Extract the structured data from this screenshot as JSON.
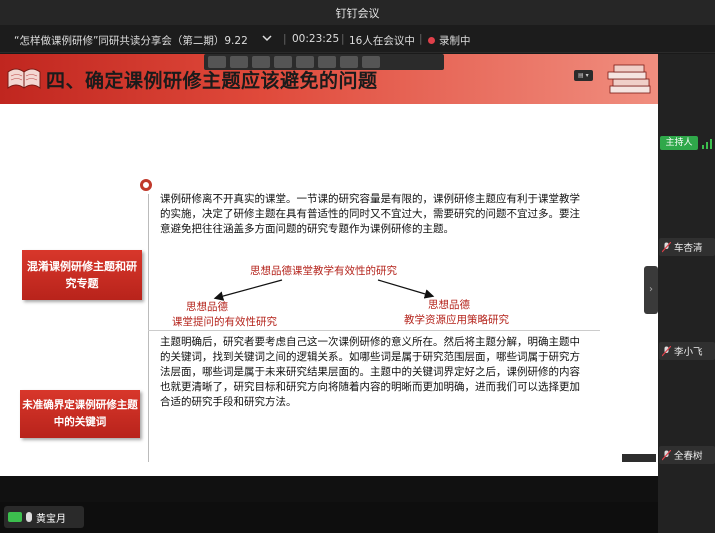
{
  "app": {
    "title": "钉钉会议"
  },
  "meeting": {
    "name": "“怎样做课例研修”同研共读分享会（第二期）9.22",
    "duration": "00:23:25",
    "attendees": "16人在会议中",
    "recording": "录制中"
  },
  "slide": {
    "title": "四、确定课例研修主题应该避免的问题",
    "para1": "课例研修离不开真实的课堂。一节课的研究容量是有限的，课例研修主题应有利于课堂教学的实施，决定了研修主题在具有普适性的同时又不宜过大，需要研究的问题不宜过多。要注意避免把往往涵盖多方面问题的研究专题作为课例研修的主题。",
    "box1": "混淆课例研修主题和研究专题",
    "diagram": {
      "top": "思想品德课堂教学有效性的研究",
      "left1": "思想品德",
      "left2": "课堂提问的有效性研究",
      "right1": "思想品德",
      "right2": "教学资源应用策略研究"
    },
    "para2": "主题明确后，研究者要考虑自己这一次课例研修的意义所在。然后将主题分解，明确主题中的关键词，找到关键词之间的逻辑关系。如哪些词是属于研究范围层面，哪些词属于研究方法层面，哪些词是属于未来研究结果层面的。主题中的关键词界定好之后，课例研修的内容也就更清晰了，研究目标和研究方向将随着内容的明晰而更加明确，进而我们可以选择更加合适的研究手段和研究方法。",
    "box2": "未准确界定课例研修主题中的关键词",
    "accent": "#c0261f"
  },
  "self_tile": {
    "name": "黄宝月"
  },
  "sidebar": {
    "host_tag": "主持人",
    "participants": [
      "车杏清",
      "李小飞",
      "全春树"
    ]
  },
  "colors": {
    "host_green": "#2fa84a",
    "record_red": "#e0404a"
  }
}
